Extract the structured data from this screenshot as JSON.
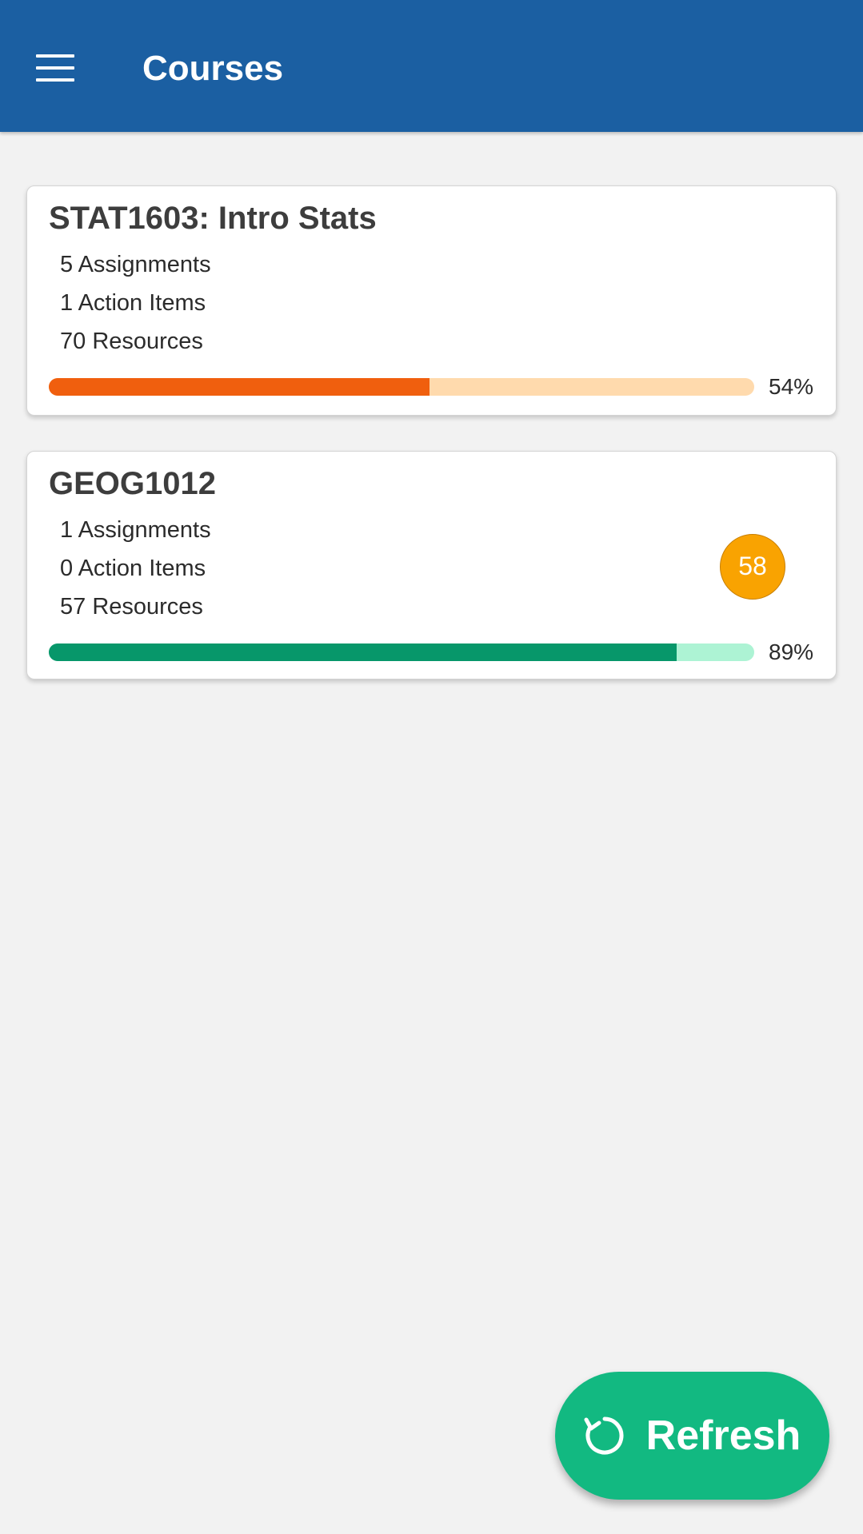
{
  "header": {
    "title": "Courses",
    "menu_icon": "hamburger-menu-icon",
    "background": "#1b5fa2"
  },
  "courses": [
    {
      "title": "STAT1603: Intro Stats",
      "assignments": "5 Assignments",
      "action_items": "1 Action Items",
      "resources": "70 Resources",
      "progress_label": "54%",
      "progress": 0.54,
      "progress_color": "#f05f0e",
      "track_color": "#ffdaad"
    },
    {
      "title": "GEOG1012",
      "assignments": "1 Assignments",
      "action_items": "0 Action Items",
      "resources": "57 Resources",
      "badge": "58",
      "badge_color": "#f9a301",
      "progress_label": "89%",
      "progress": 0.89,
      "progress_color": "#07976a",
      "track_color": "#adf3d4"
    }
  ],
  "fab": {
    "label": "Refresh",
    "icon": "refresh-icon",
    "color": "#12b981"
  }
}
